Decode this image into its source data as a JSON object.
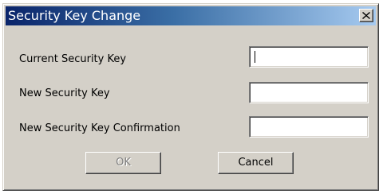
{
  "dialog": {
    "title": "Security Key Change",
    "close_icon": "close-icon"
  },
  "fields": [
    {
      "label": "Current Security Key",
      "value": "",
      "focused": true
    },
    {
      "label": "New Security Key",
      "value": "",
      "focused": false
    },
    {
      "label": "New Security Key Confirmation",
      "value": "",
      "focused": false
    }
  ],
  "buttons": {
    "ok_label": "OK",
    "ok_enabled": false,
    "cancel_label": "Cancel"
  },
  "colors": {
    "titlebar_start": "#0a246a",
    "titlebar_end": "#a6caf0",
    "dialog_face": "#d4d0c8",
    "disabled_text": "#808080"
  }
}
